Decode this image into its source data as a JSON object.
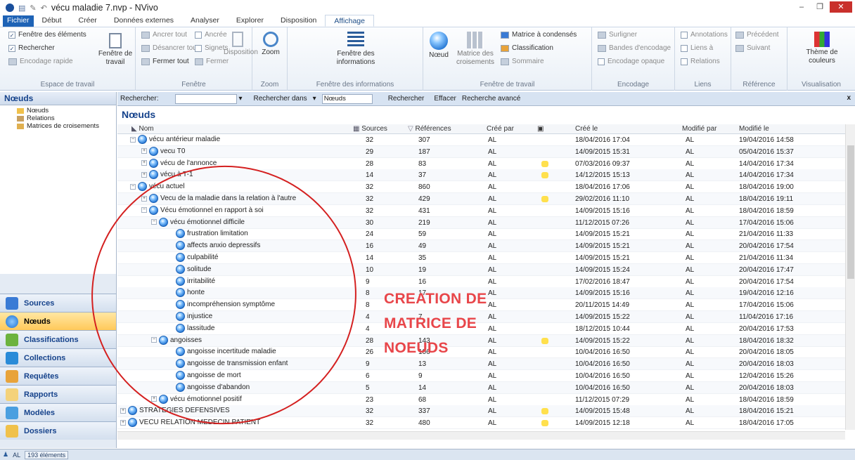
{
  "app": {
    "title": "vécu maladie 7.nvp - NVivo",
    "win_min": "–",
    "win_max": "❐",
    "win_close": "✕"
  },
  "tabs": [
    {
      "label": "Fichier"
    },
    {
      "label": "Début"
    },
    {
      "label": "Créer"
    },
    {
      "label": "Données externes"
    },
    {
      "label": "Analyser"
    },
    {
      "label": "Explorer"
    },
    {
      "label": "Disposition"
    },
    {
      "label": "Affichage"
    }
  ],
  "ribbon": {
    "espace": {
      "label": "Espace de travail",
      "fenetre_elements": "Fenêtre des éléments",
      "rechercher": "Rechercher",
      "encodage_rapide": "Encodage rapide",
      "fenetre_travail": "Fenêtre de travail"
    },
    "fenetre": {
      "label": "Fenêtre",
      "ancrer_tout": "Ancrer tout",
      "desancrer_tout": "Désancrer tout",
      "fermer_tout": "Fermer tout",
      "ancree": "Ancrée",
      "signets": "Signets",
      "fermer": "Fermer",
      "disposition": "Disposition"
    },
    "zoom": {
      "label": "Zoom",
      "btn": "Zoom"
    },
    "info": {
      "label": "Fenêtre des informations",
      "btn": "Fenêtre des informations"
    },
    "travail": {
      "label": "Fenêtre de travail",
      "noeud": "Nœud",
      "matrice": "Matrice des croisements",
      "matrice_condenses": "Matrice à condensés",
      "classification": "Classification",
      "sommaire": "Sommaire"
    },
    "encodage": {
      "label": "Encodage",
      "surligner": "Surligner",
      "bandes": "Bandes d'encodage",
      "opaque": "Encodage opaque"
    },
    "liens": {
      "label": "Liens",
      "annotations": "Annotations",
      "liens_a": "Liens à",
      "relations": "Relations"
    },
    "reference": {
      "label": "Référence",
      "precedent": "Précédent",
      "suivant": "Suivant"
    },
    "visualisation": {
      "label": "Visualisation",
      "theme": "Thème de couleurs"
    }
  },
  "nav": {
    "header": "Nœuds",
    "tree": [
      {
        "label": "Nœuds"
      },
      {
        "label": "Relations"
      },
      {
        "label": "Matrices de croisements"
      }
    ],
    "buttons": [
      {
        "label": "Sources"
      },
      {
        "label": "Nœuds"
      },
      {
        "label": "Classifications"
      },
      {
        "label": "Collections"
      },
      {
        "label": "Requêtes"
      },
      {
        "label": "Rapports"
      },
      {
        "label": "Modèles"
      },
      {
        "label": "Dossiers"
      }
    ]
  },
  "search": {
    "label": "Rechercher:",
    "search_in": "Rechercher dans",
    "scope": "Nœuds",
    "go": "Rechercher",
    "clear": "Effacer",
    "advanced": "Recherche avancé"
  },
  "list": {
    "title": "Nœuds",
    "columns": {
      "nom": "Nom",
      "sources": "Sources",
      "references": "Références",
      "cree_par": "Créé par",
      "cree_le": "Créé le",
      "modifie_par": "Modifié par",
      "modifie_le": "Modifié le"
    },
    "rows": [
      {
        "level": 1,
        "exp": "−",
        "name": "vécu antérieur maladie",
        "sources": "32",
        "refs": "307",
        "cree_par": "AL",
        "flag": false,
        "cree_le": "18/04/2016 17:04",
        "mod_par": "AL",
        "mod_le": "19/04/2016 14:58"
      },
      {
        "level": 2,
        "exp": "+",
        "name": "vecu T0",
        "sources": "29",
        "refs": "187",
        "cree_par": "AL",
        "flag": false,
        "cree_le": "14/09/2015 15:31",
        "mod_par": "AL",
        "mod_le": "05/04/2016 15:37"
      },
      {
        "level": 2,
        "exp": "+",
        "name": "vécu de l'annonce",
        "sources": "28",
        "refs": "83",
        "cree_par": "AL",
        "flag": true,
        "cree_le": "07/03/2016 09:37",
        "mod_par": "AL",
        "mod_le": "14/04/2016 17:34"
      },
      {
        "level": 2,
        "exp": "+",
        "name": "vécu à T-1",
        "sources": "14",
        "refs": "37",
        "cree_par": "AL",
        "flag": true,
        "cree_le": "14/12/2015 15:13",
        "mod_par": "AL",
        "mod_le": "14/04/2016 17:34"
      },
      {
        "level": 1,
        "exp": "−",
        "name": "vécu actuel",
        "sources": "32",
        "refs": "860",
        "cree_par": "AL",
        "flag": false,
        "cree_le": "18/04/2016 17:06",
        "mod_par": "AL",
        "mod_le": "18/04/2016 19:00"
      },
      {
        "level": 2,
        "exp": "+",
        "name": "Vecu de la maladie dans la relation à l'autre",
        "sources": "32",
        "refs": "429",
        "cree_par": "AL",
        "flag": true,
        "cree_le": "29/02/2016 11:10",
        "mod_par": "AL",
        "mod_le": "18/04/2016 19:11"
      },
      {
        "level": 2,
        "exp": "−",
        "name": "Vécu émotionnel en rapport à soi",
        "sources": "32",
        "refs": "431",
        "cree_par": "AL",
        "flag": false,
        "cree_le": "14/09/2015 15:16",
        "mod_par": "AL",
        "mod_le": "18/04/2016 18:59"
      },
      {
        "level": 3,
        "exp": "−",
        "name": "vécu émotionnel difficile",
        "sources": "30",
        "refs": "219",
        "cree_par": "AL",
        "flag": false,
        "cree_le": "11/12/2015 07:26",
        "mod_par": "AL",
        "mod_le": "17/04/2016 15:06"
      },
      {
        "level": 4,
        "exp": "",
        "name": "frustration limitation",
        "sources": "24",
        "refs": "59",
        "cree_par": "AL",
        "flag": false,
        "cree_le": "14/09/2015 15:21",
        "mod_par": "AL",
        "mod_le": "21/04/2016 11:33"
      },
      {
        "level": 4,
        "exp": "",
        "name": "affects  anxio depressifs",
        "sources": "16",
        "refs": "49",
        "cree_par": "AL",
        "flag": false,
        "cree_le": "14/09/2015 15:21",
        "mod_par": "AL",
        "mod_le": "20/04/2016 17:54"
      },
      {
        "level": 4,
        "exp": "",
        "name": "culpabilité",
        "sources": "14",
        "refs": "35",
        "cree_par": "AL",
        "flag": false,
        "cree_le": "14/09/2015 15:21",
        "mod_par": "AL",
        "mod_le": "21/04/2016 11:34"
      },
      {
        "level": 4,
        "exp": "",
        "name": "solitude",
        "sources": "10",
        "refs": "19",
        "cree_par": "AL",
        "flag": false,
        "cree_le": "14/09/2015 15:24",
        "mod_par": "AL",
        "mod_le": "20/04/2016 17:47"
      },
      {
        "level": 4,
        "exp": "",
        "name": "irritabilité",
        "sources": "9",
        "refs": "16",
        "cree_par": "AL",
        "flag": false,
        "cree_le": "17/02/2016 18:47",
        "mod_par": "AL",
        "mod_le": "20/04/2016 17:54"
      },
      {
        "level": 4,
        "exp": "",
        "name": "honte",
        "sources": "8",
        "refs": "17",
        "cree_par": "AL",
        "flag": false,
        "cree_le": "14/09/2015 15:16",
        "mod_par": "AL",
        "mod_le": "19/04/2016 12:16"
      },
      {
        "level": 4,
        "exp": "",
        "name": "incompréhension symptôme",
        "sources": "8",
        "refs": "",
        "cree_par": "AL",
        "flag": false,
        "cree_le": "20/11/2015 14:49",
        "mod_par": "AL",
        "mod_le": "17/04/2016 15:06"
      },
      {
        "level": 4,
        "exp": "",
        "name": "injustice",
        "sources": "4",
        "refs": "7",
        "cree_par": "AL",
        "flag": false,
        "cree_le": "14/09/2015 15:22",
        "mod_par": "AL",
        "mod_le": "11/04/2016 17:16"
      },
      {
        "level": 4,
        "exp": "",
        "name": "lassitude",
        "sources": "4",
        "refs": "",
        "cree_par": "AL",
        "flag": false,
        "cree_le": "18/12/2015 10:44",
        "mod_par": "AL",
        "mod_le": "20/04/2016 17:53"
      },
      {
        "level": 3,
        "exp": "−",
        "name": "angoisses",
        "sources": "28",
        "refs": "143",
        "cree_par": "AL",
        "flag": true,
        "cree_le": "14/09/2015 15:22",
        "mod_par": "AL",
        "mod_le": "18/04/2016 18:32"
      },
      {
        "level": 4,
        "exp": "",
        "name": "angoisse incertitude maladie",
        "sources": "26",
        "refs": "106",
        "cree_par": "AL",
        "flag": false,
        "cree_le": "10/04/2016 16:50",
        "mod_par": "AL",
        "mod_le": "20/04/2016 18:05"
      },
      {
        "level": 4,
        "exp": "",
        "name": "angoisse de transmission enfant",
        "sources": "9",
        "refs": "13",
        "cree_par": "AL",
        "flag": false,
        "cree_le": "10/04/2016 16:50",
        "mod_par": "AL",
        "mod_le": "20/04/2016 18:03"
      },
      {
        "level": 4,
        "exp": "",
        "name": "angoisse de mort",
        "sources": "6",
        "refs": "9",
        "cree_par": "AL",
        "flag": false,
        "cree_le": "10/04/2016 16:50",
        "mod_par": "AL",
        "mod_le": "12/04/2016 15:26"
      },
      {
        "level": 4,
        "exp": "",
        "name": "angoisse d'abandon",
        "sources": "5",
        "refs": "14",
        "cree_par": "AL",
        "flag": false,
        "cree_le": "10/04/2016 16:50",
        "mod_par": "AL",
        "mod_le": "20/04/2016 18:03"
      },
      {
        "level": 3,
        "exp": "+",
        "name": "vécu émotionnel positif",
        "sources": "23",
        "refs": "68",
        "cree_par": "AL",
        "flag": false,
        "cree_le": "11/12/2015 07:29",
        "mod_par": "AL",
        "mod_le": "18/04/2016 18:59"
      },
      {
        "level": 0,
        "exp": "+",
        "name": "STRATEGIES DEFENSIVES",
        "sources": "32",
        "refs": "337",
        "cree_par": "AL",
        "flag": true,
        "cree_le": "14/09/2015 15:48",
        "mod_par": "AL",
        "mod_le": "18/04/2016 15:21"
      },
      {
        "level": 0,
        "exp": "+",
        "name": "VECU RELATION MEDECIN PATIENT",
        "sources": "32",
        "refs": "480",
        "cree_par": "AL",
        "flag": true,
        "cree_le": "14/09/2015 12:18",
        "mod_par": "AL",
        "mod_le": "18/04/2016 17:05"
      }
    ]
  },
  "annotation": {
    "line1": "CREATION DE",
    "line2": "MATRICE DE",
    "line3": "NOEUDS"
  },
  "status": {
    "user": "AL",
    "count": "193 éléments"
  }
}
